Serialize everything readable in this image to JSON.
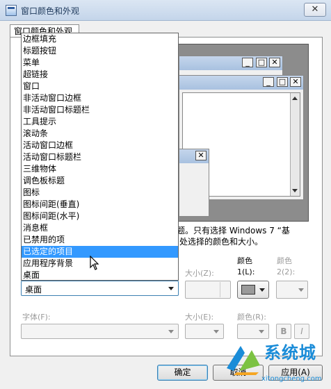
{
  "window": {
    "title": "窗口颜色和外观"
  },
  "tab": {
    "label": "窗口颜色和外观"
  },
  "description": {
    "line1": "主题。只有选择 Windows 7 “基",
    "line2": "处选择的颜色和大小。"
  },
  "dropdown_items": [
    "边框填充",
    "标题按钮",
    "菜单",
    "超链接",
    "窗口",
    "非活动窗口边框",
    "非活动窗口标题栏",
    "工具提示",
    "滚动条",
    "活动窗口边框",
    "活动窗口标题栏",
    "三维物体",
    "调色板标题",
    "图标",
    "图标间距(垂直)",
    "图标间距(水平)",
    "消息框",
    "已禁用的项",
    "已选定的项目",
    "应用程序背景",
    "桌面"
  ],
  "selected_index": 18,
  "item_combo": {
    "value": "桌面"
  },
  "size_label": "大小(Z):",
  "color1_label_a": "颜色",
  "color1_label_b": "1(L):",
  "color2_label_a": "颜色",
  "color2_label_b": "2(2):",
  "font_label": "字体(F):",
  "font_size_label": "大小(E):",
  "font_color_label": "颜色(R):",
  "bold_label": "B",
  "italic_label": "I",
  "buttons": {
    "ok": "确定",
    "cancel": "取消",
    "apply": "应用(A)"
  },
  "watermark": {
    "text": "系统城",
    "url": "xitongcheng.com"
  },
  "colors": {
    "accent_selection": "#3399ff",
    "color1_swatch": "#9a9a9a"
  },
  "icons": {
    "close": "close-icon",
    "minimize": "minimize-icon",
    "maximize": "maximize-icon",
    "dropdown": "chevron-down-icon"
  }
}
